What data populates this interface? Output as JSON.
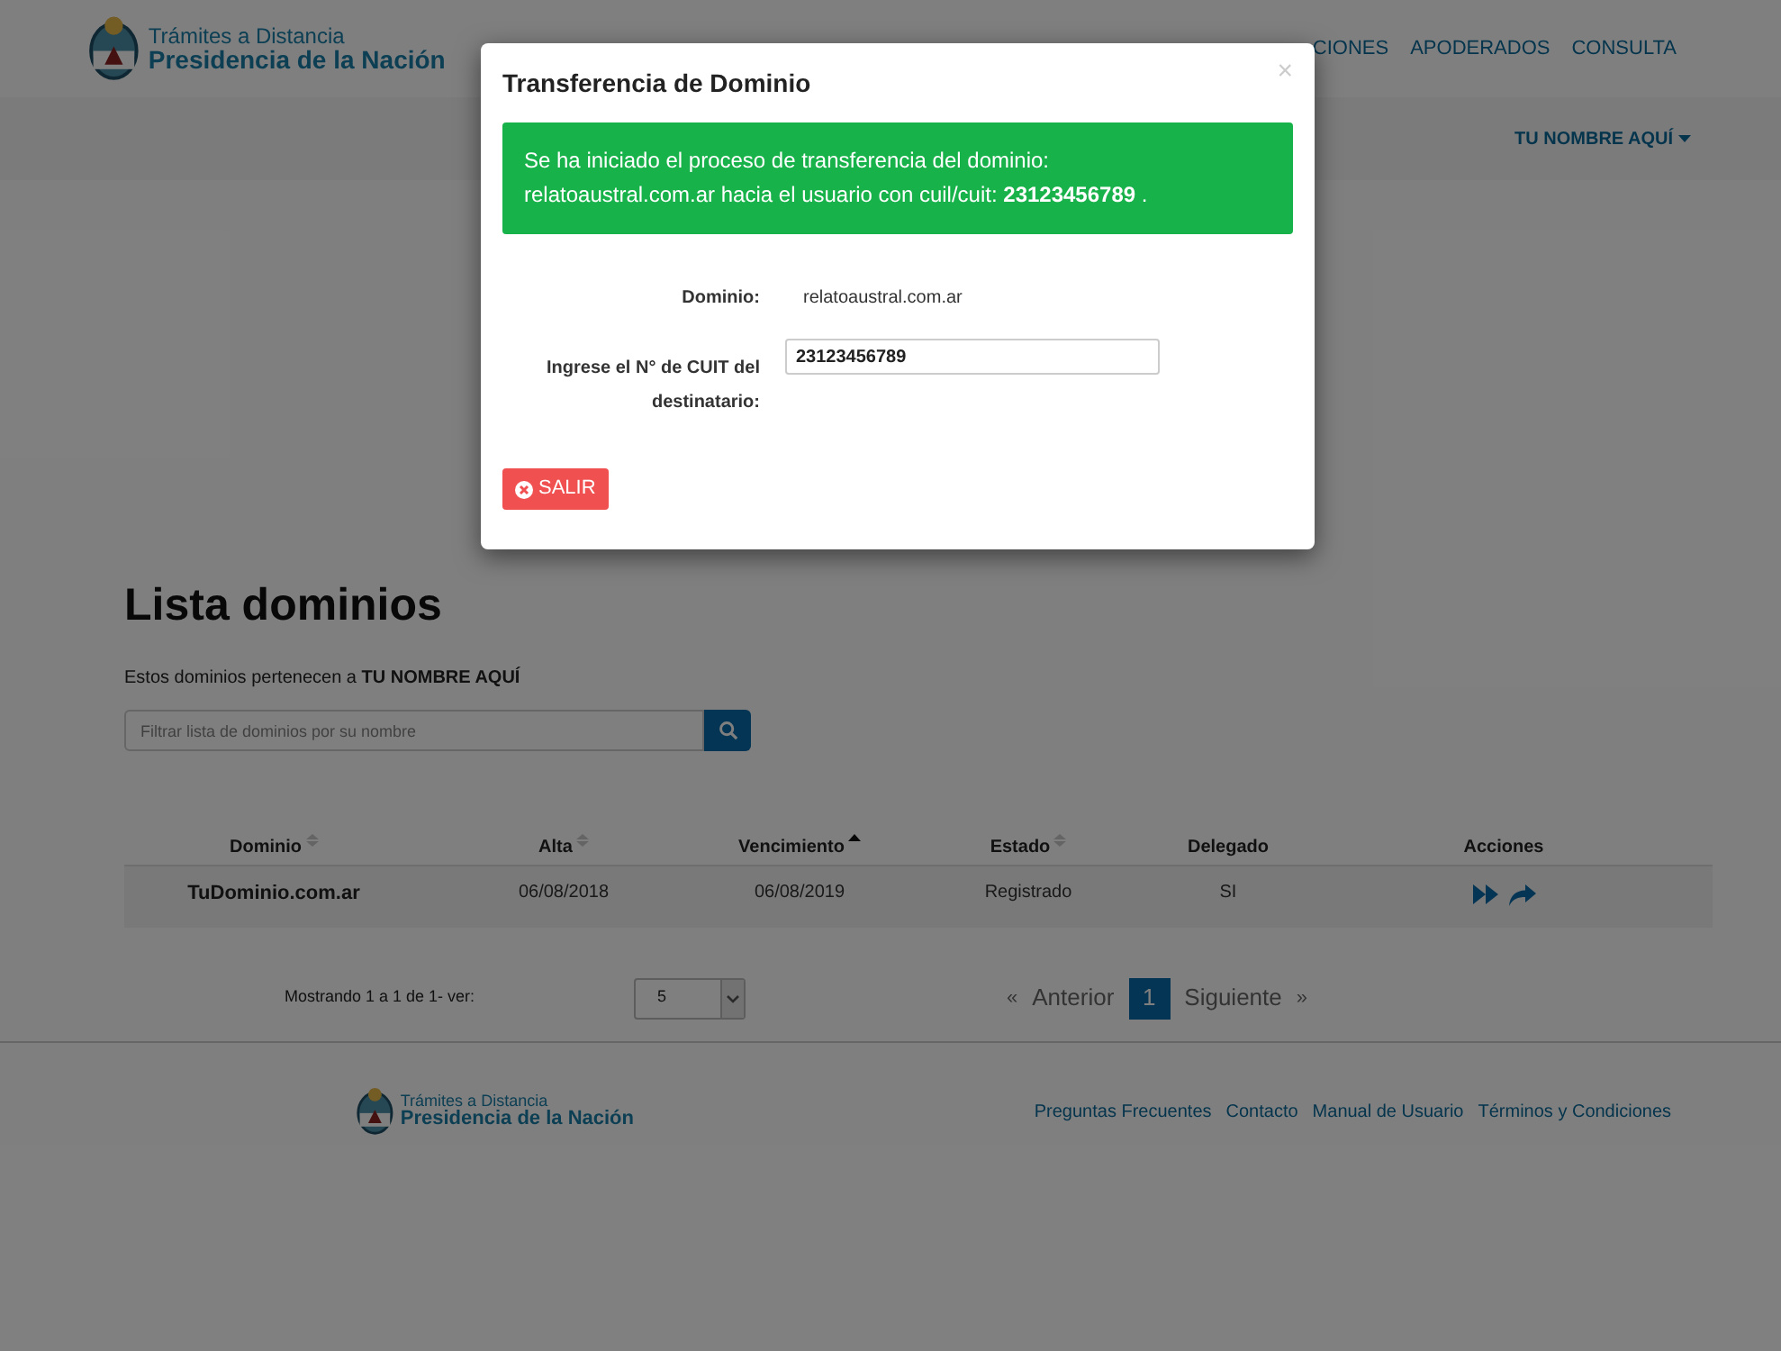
{
  "header": {
    "logo_line1": "Trámites a Distancia",
    "logo_line2": "Presidencia de la Nación",
    "nav": [
      {
        "label": "CIONES"
      },
      {
        "label": "APODERADOS"
      },
      {
        "label": "CONSULTA"
      }
    ],
    "user_menu": "TU NOMBRE AQUÍ"
  },
  "page": {
    "title": "Lista dominios",
    "owner_prefix": "Estos dominios pertenecen a ",
    "owner": "TU NOMBRE AQUÍ",
    "filter": {
      "placeholder": "Filtrar lista de dominios por su nombre"
    },
    "table": {
      "columns": [
        {
          "label": "Dominio",
          "sorted": false
        },
        {
          "label": "Alta",
          "sorted": false
        },
        {
          "label": "Vencimiento",
          "sorted": true
        },
        {
          "label": "Estado",
          "sorted": false
        },
        {
          "label": "Delegado"
        },
        {
          "label": "Acciones"
        }
      ],
      "rows": [
        {
          "cells": [
            "TuDominio.com.ar",
            "06/08/2018",
            "06/08/2019",
            "Registrado",
            "SI"
          ]
        }
      ]
    },
    "showing": "Mostrando 1 a 1 de 1- ver:",
    "page_size": "5",
    "pagination": [
      {
        "label": "«",
        "kind": "arrow",
        "disabled": true
      },
      {
        "label": "Anterior",
        "kind": "text",
        "disabled": true
      },
      {
        "label": "1",
        "kind": "page",
        "selected": true
      },
      {
        "label": "Siguiente",
        "kind": "text",
        "disabled": true
      },
      {
        "label": "»",
        "kind": "arrow",
        "disabled": true
      }
    ]
  },
  "footer": {
    "logo_line1": "Trámites a Distancia",
    "logo_line2": "Presidencia de la Nación",
    "links": [
      "Preguntas Frecuentes",
      "Contacto",
      "Manual de Usuario",
      "Términos y Condiciones"
    ]
  },
  "modal": {
    "title": "Transferencia de Dominio",
    "close": "×",
    "alert": "Se ha iniciado el proceso de transferencia del dominio: relatoaustral.com.ar hacia el usuario con cuil/cuit: **23123456789** .",
    "domain_label": "Dominio:",
    "domain_value": "relatoaustral.com.ar",
    "cuit_label": "Ingrese el N° de CUIT del destinatario:",
    "cuit_value": "23123456789",
    "exit_button": "SALIR"
  }
}
